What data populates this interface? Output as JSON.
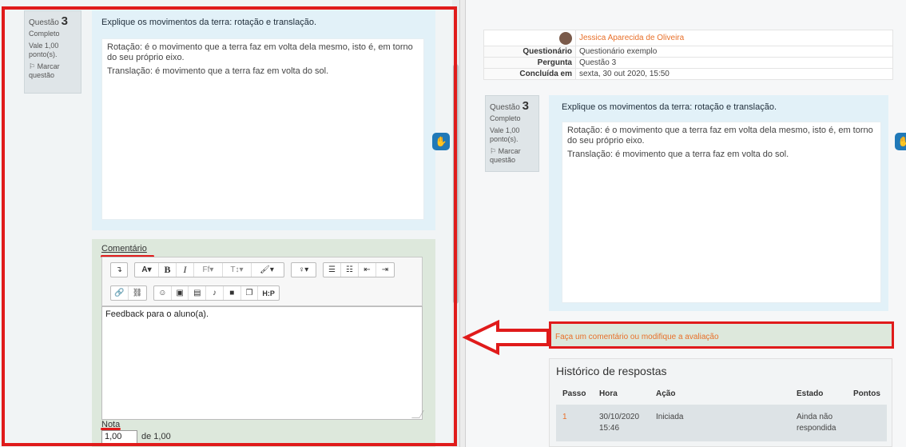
{
  "question": {
    "qno_label": "Questão",
    "qno_number": "3",
    "status": "Completo",
    "mark_line1": "Vale 1,00",
    "mark_line2": "ponto(s).",
    "flag_line1": "Marcar",
    "flag_line2": "questão",
    "title": "Explique os movimentos da terra: rotação e translação.",
    "answer_p1": "Rotação: é o movimento que a terra faz em volta dela mesmo, isto é, em torno do seu próprio eixo.",
    "answer_p2": "Translação: é movimento que a terra faz em volta do sol."
  },
  "comment": {
    "label": "Comentário",
    "editor_text": "Feedback para o aluno(a).",
    "toolbar_icons": [
      "undo-icon",
      "font-size-icon",
      "bold-icon",
      "italic-icon",
      "font-family-icon",
      "paragraph-style-icon",
      "brush-icon",
      "lightbulb-icon",
      "unordered-list-icon",
      "ordered-list-icon",
      "outdent-icon",
      "indent-icon",
      "link-icon",
      "unlink-icon",
      "emoji-icon",
      "image-icon",
      "media-icon",
      "microphone-icon",
      "video-icon",
      "copy-icon",
      "h5p-icon"
    ],
    "h5p_label": "H:P"
  },
  "grade": {
    "label": "Nota",
    "value": "1,00",
    "max": "de 1,00"
  },
  "summary": {
    "user_name": "Jessica Aparecida de Oliveira",
    "rows": [
      {
        "key": "Questionário",
        "value": "Questionário exemplo"
      },
      {
        "key": "Pergunta",
        "value": "Questão 3"
      },
      {
        "key": "Concluída em",
        "value": "sexta, 30 out 2020, 15:50"
      }
    ]
  },
  "feedback_link": "Faça um comentário ou modifique a avaliação",
  "history": {
    "title": "Histórico de respostas",
    "headers": [
      "Passo",
      "Hora",
      "Ação",
      "Estado",
      "Pontos"
    ],
    "rows": [
      {
        "step": "1",
        "time_line1": "30/10/2020",
        "time_line2": "15:46",
        "action": "Iniciada",
        "state_line1": "Ainda não",
        "state_line2": "respondida",
        "points": ""
      }
    ]
  },
  "colors": {
    "highlight_red": "#e01b1b",
    "link_orange": "#e8702a",
    "question_bg": "#e2f1f8",
    "comment_bg": "#dde8dc",
    "accessibility_blue": "#2079b8"
  }
}
